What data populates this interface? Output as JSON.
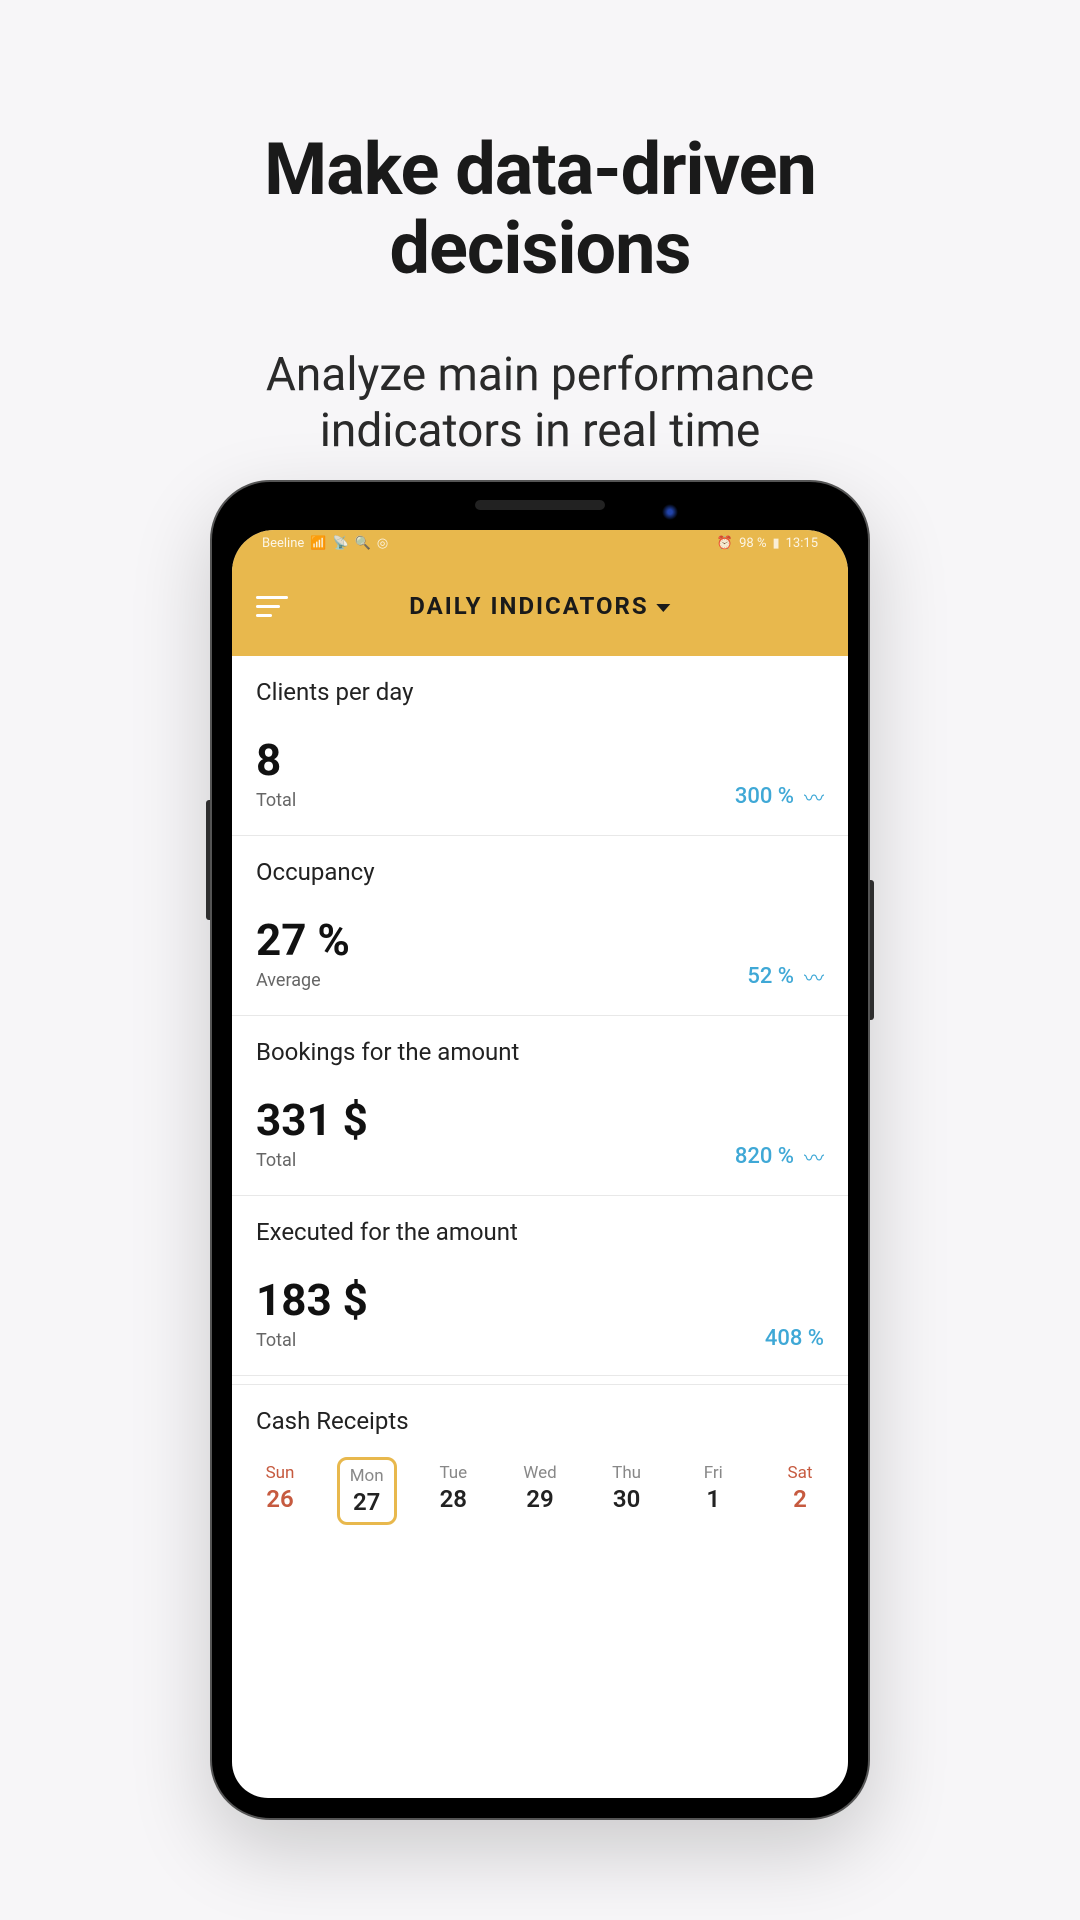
{
  "hero": {
    "title_line1": "Make data-driven",
    "title_line2": "decisions",
    "subtitle_line1": "Analyze main performance",
    "subtitle_line2": "indicators in real time"
  },
  "status": {
    "carrier": "Beeline",
    "battery": "98 %",
    "time": "13:15",
    "alarm_icon": "⏰",
    "battery_icon": "▮"
  },
  "header": {
    "title": "DAILY INDICATORS"
  },
  "cards": [
    {
      "title": "Clients per day",
      "value": "8",
      "sub": "Total",
      "trend": "300 %",
      "trend_icon": true
    },
    {
      "title": "Occupancy",
      "value": "27 %",
      "sub": "Average",
      "trend": "52 %",
      "trend_icon": true
    },
    {
      "title": "Bookings for the amount",
      "value": "331 $",
      "sub": "Total",
      "trend": "820 %",
      "trend_icon": true
    },
    {
      "title": "Executed for the amount",
      "value": "183 $",
      "sub": "Total",
      "trend": "408 %",
      "trend_icon": false
    }
  ],
  "receipts": {
    "title": "Cash Receipts"
  },
  "calendar": [
    {
      "name": "Sun",
      "num": "26",
      "weekend": true,
      "selected": false
    },
    {
      "name": "Mon",
      "num": "27",
      "weekend": false,
      "selected": true
    },
    {
      "name": "Tue",
      "num": "28",
      "weekend": false,
      "selected": false
    },
    {
      "name": "Wed",
      "num": "29",
      "weekend": false,
      "selected": false
    },
    {
      "name": "Thu",
      "num": "30",
      "weekend": false,
      "selected": false
    },
    {
      "name": "Fri",
      "num": "1",
      "weekend": false,
      "selected": false
    },
    {
      "name": "Sat",
      "num": "2",
      "weekend": true,
      "selected": false
    }
  ]
}
